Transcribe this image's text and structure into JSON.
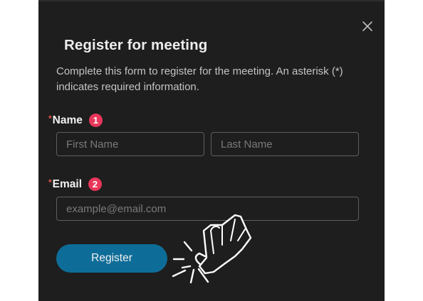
{
  "dialog": {
    "title": "Register for meeting",
    "description": "Complete this form to register for the meeting. An asterisk (*) indicates required information.",
    "close_icon": "close-icon"
  },
  "fields": {
    "required_marker": "*",
    "name": {
      "label": "Name",
      "step": "1",
      "first_placeholder": "First Name",
      "last_placeholder": "Last Name"
    },
    "email": {
      "label": "Email",
      "step": "2",
      "placeholder": "example@email.com"
    }
  },
  "actions": {
    "register_label": "Register"
  },
  "overlay": {
    "cursor_icon": "hand-pointer-icon",
    "click_effect": "click-burst-icon"
  },
  "colors": {
    "background": "#1e1e1e",
    "accent": "#0e6d98",
    "badge": "#e8375a",
    "required": "#e2564a"
  }
}
